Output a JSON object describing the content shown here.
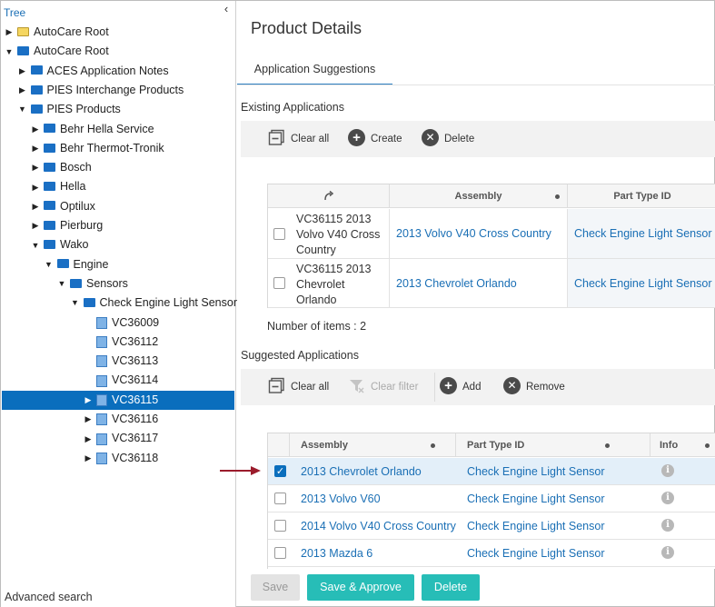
{
  "tree": {
    "title": "Tree",
    "collapse_icon": "chevron-left-icon",
    "footer": "Advanced search",
    "nodes": [
      {
        "label": "AutoCare Root",
        "toggle": "▶",
        "icon": "folder-yellow"
      },
      {
        "label": "AutoCare Root",
        "toggle": "▼",
        "icon": "folder-blue"
      },
      {
        "label": "ACES Application Notes",
        "toggle": "▶",
        "icon": "folder-blue"
      },
      {
        "label": "PIES Interchange Products",
        "toggle": "▶",
        "icon": "folder-blue"
      },
      {
        "label": "PIES Products",
        "toggle": "▼",
        "icon": "folder-blue"
      },
      {
        "label": "Behr Hella Service",
        "toggle": "▶",
        "icon": "folder-blue"
      },
      {
        "label": "Behr Thermot-Tronik",
        "toggle": "▶",
        "icon": "folder-blue"
      },
      {
        "label": "Bosch",
        "toggle": "▶",
        "icon": "folder-blue"
      },
      {
        "label": "Hella",
        "toggle": "▶",
        "icon": "folder-blue"
      },
      {
        "label": "Optilux",
        "toggle": "▶",
        "icon": "folder-blue"
      },
      {
        "label": "Pierburg",
        "toggle": "▶",
        "icon": "folder-blue"
      },
      {
        "label": "Wako",
        "toggle": "▼",
        "icon": "folder-blue"
      },
      {
        "label": "Engine",
        "toggle": "▼",
        "icon": "folder-blue"
      },
      {
        "label": "Sensors",
        "toggle": "▼",
        "icon": "folder-blue"
      },
      {
        "label": "Check Engine Light Sensor",
        "toggle": "▼",
        "icon": "folder-blue"
      },
      {
        "label": "VC36009",
        "toggle": "",
        "icon": "cube"
      },
      {
        "label": "VC36112",
        "toggle": "",
        "icon": "cube"
      },
      {
        "label": "VC36113",
        "toggle": "",
        "icon": "cube"
      },
      {
        "label": "VC36114",
        "toggle": "",
        "icon": "cube"
      },
      {
        "label": "VC36115",
        "toggle": "▶",
        "icon": "cube"
      },
      {
        "label": "VC36116",
        "toggle": "▶",
        "icon": "cube"
      },
      {
        "label": "VC36117",
        "toggle": "▶",
        "icon": "cube"
      },
      {
        "label": "VC36118",
        "toggle": "▶",
        "icon": "cube"
      }
    ]
  },
  "header": {
    "title": "Product Details",
    "tab": "Application Suggestions"
  },
  "existing": {
    "title": "Existing Applications",
    "toolbar": {
      "clear_all": "Clear all",
      "create": "Create",
      "delete": "Delete"
    },
    "columns": {
      "assembly": "Assembly",
      "part_type": "Part Type ID"
    },
    "rows": [
      {
        "product": "VC36115 2013 Volvo V40 Cross Country",
        "assembly": "2013 Volvo V40 Cross Country",
        "part_type": "Check Engine Light Sensor"
      },
      {
        "product": "VC36115 2013 Chevrolet Orlando",
        "assembly": "2013 Chevrolet Orlando",
        "part_type": "Check Engine Light Sensor"
      }
    ],
    "count": "Number of items : 2"
  },
  "suggested": {
    "title": "Suggested Applications",
    "toolbar": {
      "clear_all": "Clear all",
      "clear_filter": "Clear filter",
      "add": "Add",
      "remove": "Remove"
    },
    "columns": {
      "assembly": "Assembly",
      "part_type": "Part Type ID",
      "info": "Info"
    },
    "rows": [
      {
        "assembly": "2013 Chevrolet Orlando",
        "part_type": "Check Engine Light Sensor",
        "checked": true
      },
      {
        "assembly": "2013 Volvo V60",
        "part_type": "Check Engine Light Sensor",
        "checked": false
      },
      {
        "assembly": "2014 Volvo V40 Cross Country",
        "part_type": "Check Engine Light Sensor",
        "checked": false
      },
      {
        "assembly": "2013 Mazda 6",
        "part_type": "Check Engine Light Sensor",
        "checked": false
      }
    ]
  },
  "footer": {
    "save": "Save",
    "save_approve": "Save & Approve",
    "delete": "Delete"
  },
  "colors": {
    "accent": "#0a6ebd",
    "link": "#1a6fb5",
    "teal": "#27bdb7",
    "selected_row": "#e3eff9",
    "arrow": "#9b1c2c"
  }
}
